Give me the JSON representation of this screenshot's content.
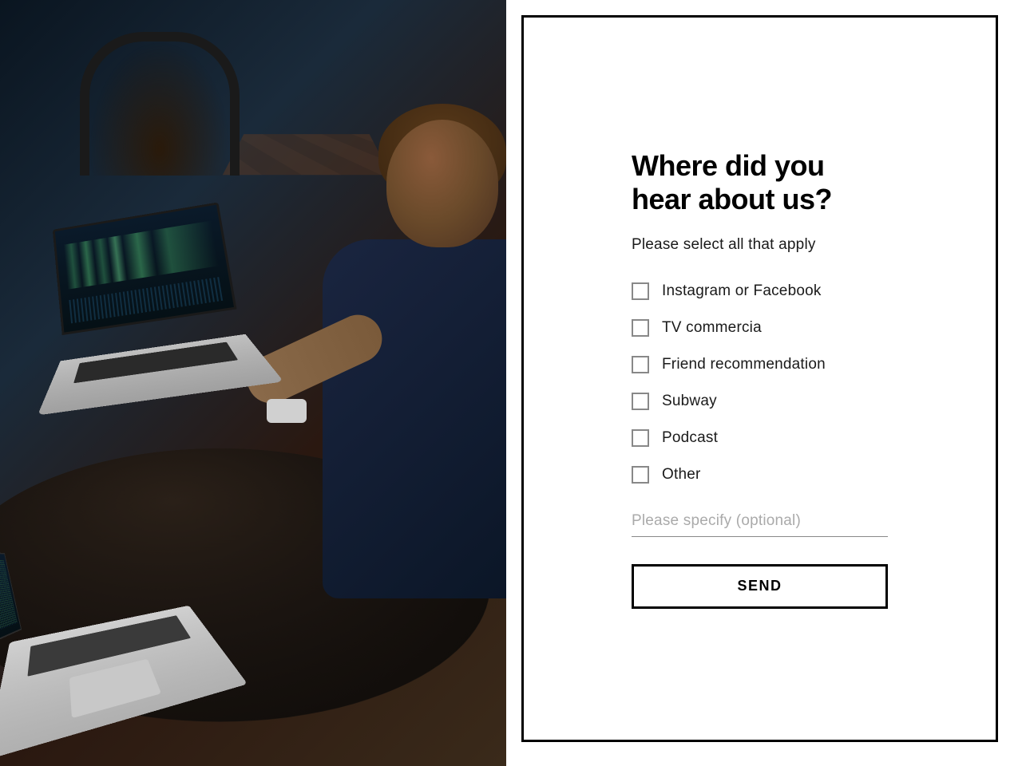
{
  "form": {
    "heading": "Where did you hear about us?",
    "subheading": "Please select all that apply",
    "options": [
      "Instagram or Facebook",
      "TV commercia",
      "Friend recommendation",
      "Subway",
      "Podcast",
      "Other"
    ],
    "specify_placeholder": "Please specify (optional)",
    "submit_label": "SEND"
  }
}
